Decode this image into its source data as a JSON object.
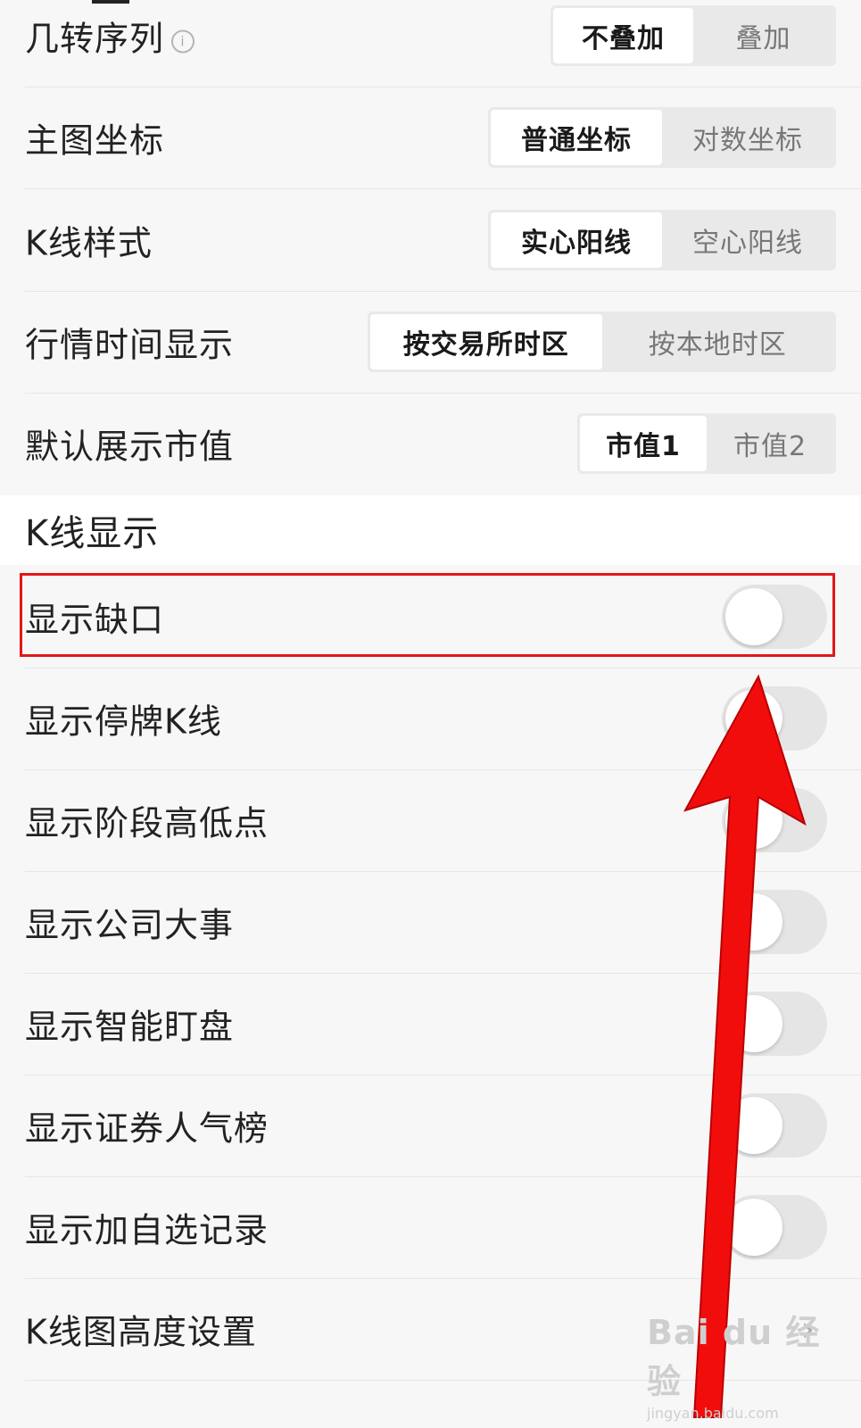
{
  "settings_rows": [
    {
      "label": "几转序列",
      "options": [
        "不叠加",
        "叠加"
      ],
      "selected": 0
    },
    {
      "label": "主图坐标",
      "options": [
        "普通坐标",
        "对数坐标"
      ],
      "selected": 0
    },
    {
      "label": "K线样式",
      "options": [
        "实心阳线",
        "空心阳线"
      ],
      "selected": 0
    },
    {
      "label": "行情时间显示",
      "options": [
        "按交易所时区",
        "按本地时区"
      ],
      "selected": 0
    },
    {
      "label": "默认展示市值",
      "options": [
        "市值1",
        "市值2"
      ],
      "selected": 0
    }
  ],
  "info_icon_glyph": "i",
  "section_title": "K线显示",
  "toggle_rows": [
    {
      "label": "显示缺口",
      "on": false
    },
    {
      "label": "显示停牌K线",
      "on": false
    },
    {
      "label": "显示阶段高低点",
      "on": false
    },
    {
      "label": "显示公司大事",
      "on": false
    },
    {
      "label": "显示智能盯盘",
      "on": false
    },
    {
      "label": "显示证券人气榜",
      "on": false
    },
    {
      "label": "显示加自选记录",
      "on": false
    }
  ],
  "nav_row": {
    "label": "K线图高度设置",
    "chevron": "›"
  },
  "watermark": {
    "brand": "Bai du 经验",
    "url": "jingyan.baidu.com"
  },
  "colors": {
    "annotation_red": "#e01818",
    "toggle_off": "#e5e5e5",
    "segment_bg": "#e9e9e9"
  }
}
